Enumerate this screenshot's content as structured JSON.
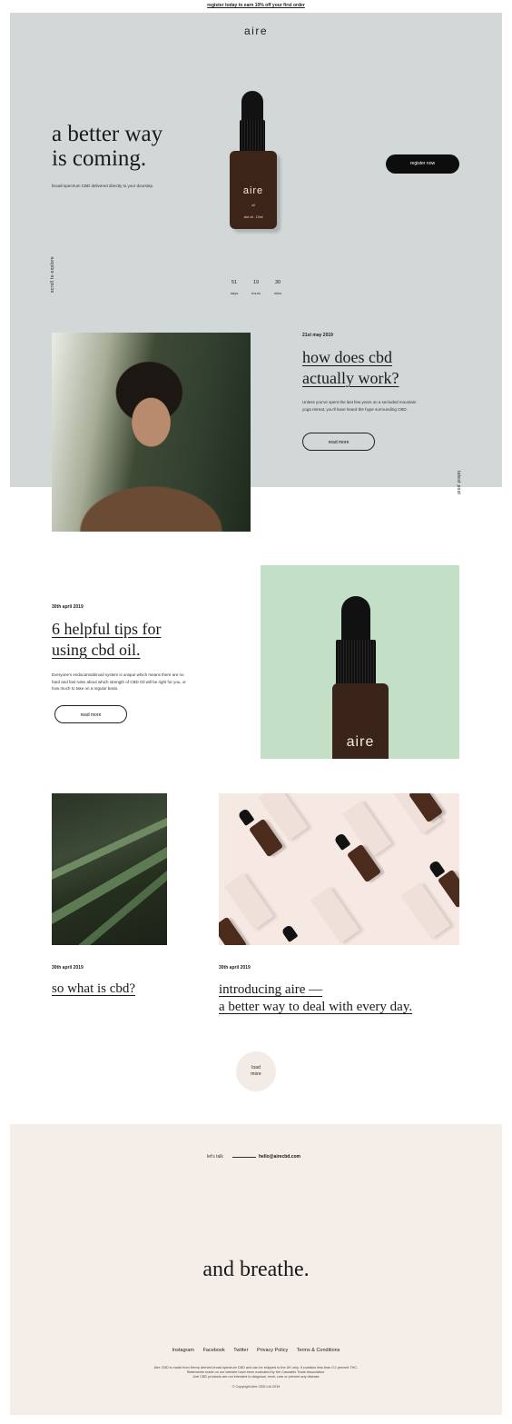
{
  "promo": {
    "text": "register today to earn 10% off your first order"
  },
  "brand": {
    "logo": "aire"
  },
  "hero": {
    "title_line1": "a better way",
    "title_line2": "is coming.",
    "subtitle": "broad-spectrum CBD delivered directly to your doorstep.",
    "scroll_label": "scroll to explore",
    "cta_label": "register now",
    "bottle": {
      "brand": "aire",
      "type": "oil",
      "size": "cbd oil - 10ml"
    },
    "countdown": [
      {
        "value": "51",
        "unit": "days"
      },
      {
        "value": "19",
        "unit": "hours"
      },
      {
        "value": "30",
        "unit": "mins"
      }
    ]
  },
  "latest": {
    "label": "latest post",
    "date": "21st may 2019",
    "title_line1": "how does cbd",
    "title_line2": "actually work?",
    "excerpt": "Unless you've spent the last few years on a secluded mountain yoga retreat, you'll have heard the hype surrounding CBD.",
    "button": "read more"
  },
  "tips": {
    "date": "30th april 2019",
    "title_line1": "6 helpful tips for",
    "title_line2": "using cbd oil.",
    "excerpt": "Everyone's endocannabinoid system is unique which means there are no hard and fast rules about which strength of CBD Oil will be right for you, or how much to take on a regular basis.",
    "button": "read more",
    "bottle_brand": "aire"
  },
  "grid": [
    {
      "date": "30th april 2019",
      "title": "so what is cbd?"
    },
    {
      "date": "30th april 2019",
      "title_line1": "introducing aire —",
      "title_line2": "a better way to deal with every day."
    }
  ],
  "load_more": {
    "line1": "load",
    "line2": "more"
  },
  "footer": {
    "lets_talk": "let's talk",
    "email": "hello@airecbd.com",
    "tagline": "and breathe.",
    "links": [
      "Instagram",
      "Facebook",
      "Twitter",
      "Privacy Policy",
      "Terms & Conditions"
    ],
    "legal_line1": "Aire CBD is made from Hemp derived broad spectrum CBD and can be shipped to the UK only. It contains less than 0.2 percent THC.",
    "legal_line2": "Statements made on our website have been evaluated by the Cannabis Trade Association.",
    "legal_line3": "Aire CBD products are not intended to diagnose, treat, cure or prevent any disease",
    "copyright": "© Copyright Aire CBD Ltd 2019"
  },
  "colors": {
    "hero_bg": "#d2d8d8",
    "green_panel": "#c3dfc6",
    "footer_bg": "#f5ede8",
    "bottle_brown": "#3d2418",
    "button_dark": "#0d0d0d"
  }
}
